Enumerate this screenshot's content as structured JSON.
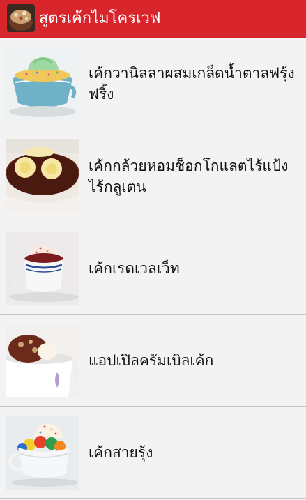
{
  "app": {
    "title": "สูตรเค้กไมโครเวฟ",
    "icon": "cake-app-icon",
    "bar_color": "#d8252b"
  },
  "recipes": [
    {
      "title": "เค้กวานิลลาผสมเกล็ดน้ำตาลฟรุ้งฟริ้ง",
      "image": "vanilla-cupcake-in-teacup"
    },
    {
      "title": "เค้กกล้วยหอมช็อกโกแลตไร้แป้งไร้กลูเตน",
      "image": "banana-chocolate-mug-cake"
    },
    {
      "title": "เค้กเรดเวลเว็ท",
      "image": "red-velvet-cup-cake"
    },
    {
      "title": "แอปเปิลครัมเบิลเค้ก",
      "image": "apple-crumble-mug-cake"
    },
    {
      "title": "เค้กสายรุ้ง",
      "image": "rainbow-cake-in-cup"
    }
  ]
}
